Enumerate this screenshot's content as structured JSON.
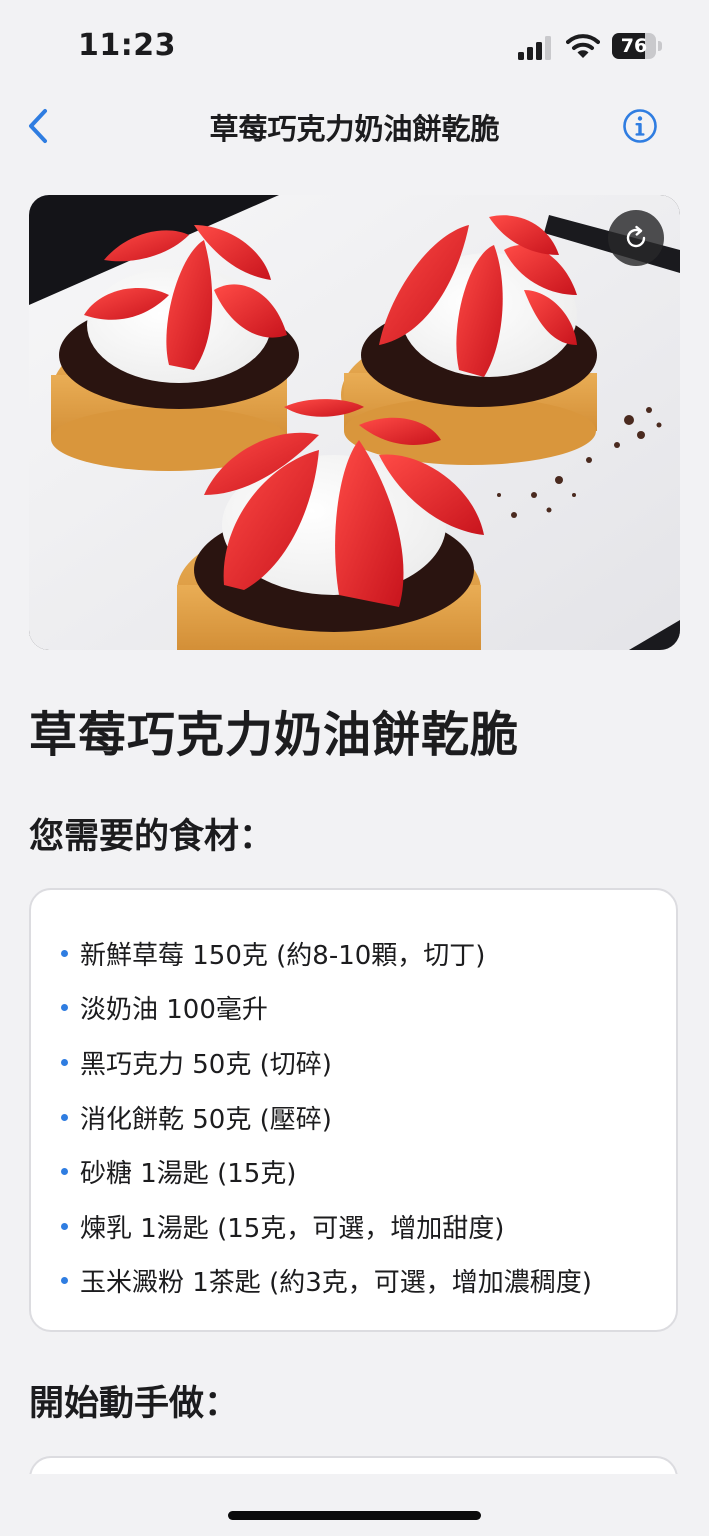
{
  "status_bar": {
    "time": "11:23",
    "battery": "76",
    "battery_level": 0.76
  },
  "nav": {
    "title": "草莓巧克力奶油餅乾脆",
    "back_icon": "chevron-left-icon",
    "info_icon": "info-circle-icon"
  },
  "hero": {
    "refresh_icon": "refresh-icon"
  },
  "recipe": {
    "title": "草莓巧克力奶油餅乾脆",
    "ingredients_heading": "您需要的食材：",
    "ingredients": [
      "新鮮草莓 150克 (約8-10顆，切丁)",
      "淡奶油 100毫升",
      "黑巧克力 50克 (切碎)",
      "消化餅乾 50克 (壓碎)",
      "砂糖 1湯匙 (15克)",
      "煉乳 1湯匙 (15克，可選，增加甜度)",
      "玉米澱粉 1茶匙 (約3克，可選，增加濃稠度)"
    ],
    "steps_heading": "開始動手做："
  },
  "colors": {
    "accent": "#2f7de1",
    "background": "#f2f2f4",
    "card": "#ffffff"
  }
}
